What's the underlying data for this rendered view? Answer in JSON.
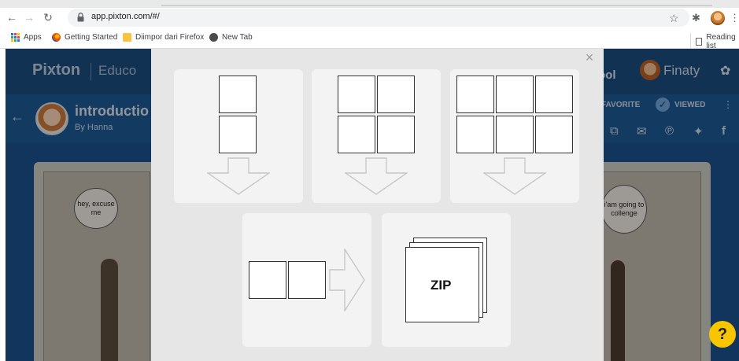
{
  "browser": {
    "url": "app.pixton.com/#/",
    "bookmarks": [
      {
        "label": "Apps",
        "icon": "apps-grid-icon"
      },
      {
        "label": "Getting Started",
        "icon": "firefox-icon"
      },
      {
        "label": "Diimpor dari Firefox",
        "icon": "folder-icon"
      },
      {
        "label": "New Tab",
        "icon": "globe-icon"
      }
    ],
    "reading_list": "Reading list"
  },
  "page": {
    "logo": "Pixton",
    "logo_suffix": "Educo",
    "school_fragment": "ool",
    "user_name": "Finaty",
    "comic_title": "introductio",
    "comic_author": "By Hanna",
    "favorite_label": "FAVORITE",
    "viewed_label": "VIEWED",
    "bubble_left": "hey, excuse me",
    "bubble_right": "i'am going to collenge"
  },
  "modal": {
    "close_symbol": "×",
    "options": [
      {
        "name": "vertical-strip",
        "frames": "1 column × 2 rows",
        "arrow": "down"
      },
      {
        "name": "grid-2x2",
        "frames": "2 columns × 2 rows",
        "arrow": "down"
      },
      {
        "name": "grid-3x2",
        "frames": "3 columns × 2 rows",
        "arrow": "down"
      },
      {
        "name": "horizontal-strip",
        "frames": "2 columns × 1 row",
        "arrow": "right"
      },
      {
        "name": "zip-download",
        "label": "ZIP"
      }
    ],
    "zip_label": "ZIP"
  },
  "help": {
    "label": "?"
  },
  "colors": {
    "modal_bg": "#e6e6e6",
    "option_bg": "#f3f3f3",
    "page_header": "#1b4a7c",
    "help_button": "#f7c600"
  }
}
